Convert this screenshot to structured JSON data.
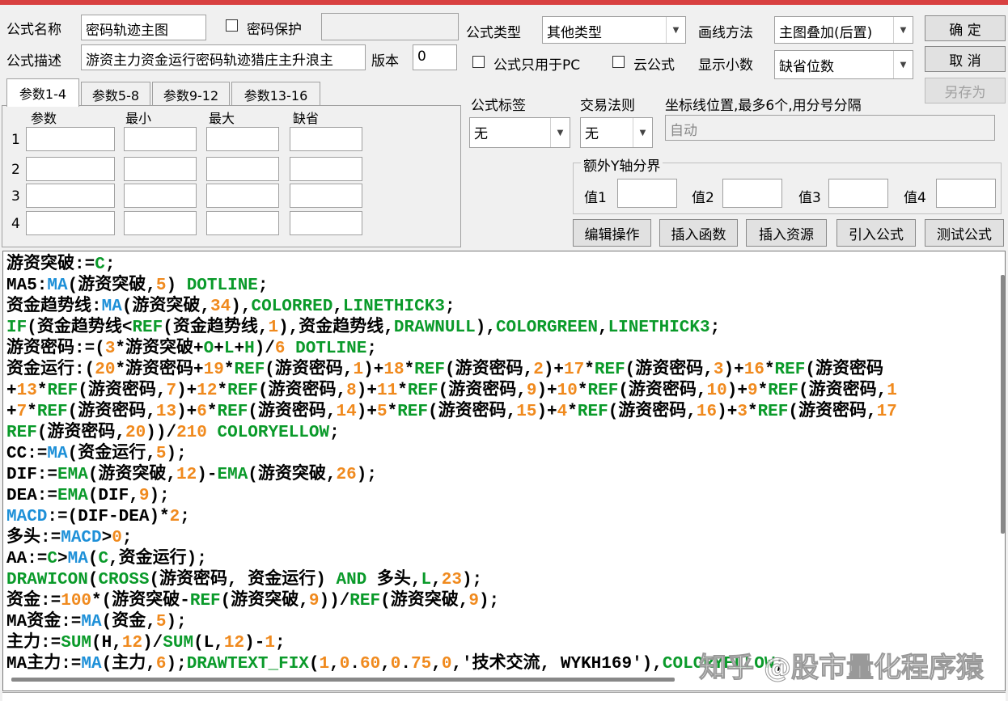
{
  "form": {
    "name_label": "公式名称",
    "name_value": "密码轨迹主图",
    "password_label": "密码保护",
    "password_value": "",
    "desc_label": "公式描述",
    "desc_value": "游资主力资金运行密码轨迹猎庄主升浪主",
    "version_label": "版本",
    "version_value": "0",
    "type_label": "公式类型",
    "type_value": "其他类型",
    "draw_label": "画线方法",
    "draw_value": "主图叠加(后置)",
    "pc_only_label": "公式只用于PC",
    "cloud_label": "云公式",
    "decimal_label": "显示小数",
    "decimal_value": "缺省位数",
    "ok": "确  定",
    "cancel": "取  消",
    "save_as": "另存为"
  },
  "tabs": [
    "参数1-4",
    "参数5-8",
    "参数9-12",
    "参数13-16"
  ],
  "params": {
    "headers": [
      "参数",
      "最小",
      "最大",
      "缺省"
    ],
    "rows": [
      "1",
      "2",
      "3",
      "4"
    ]
  },
  "tag": {
    "label": "公式标签",
    "value": "无"
  },
  "rule": {
    "label": "交易法则",
    "value": "无"
  },
  "axis": {
    "label": "坐标线位置,最多6个,用分号分隔",
    "value": "自动"
  },
  "yaxis": {
    "title": "额外Y轴分界",
    "fields": [
      "值1",
      "值2",
      "值3",
      "值4"
    ]
  },
  "actions": [
    "编辑操作",
    "插入函数",
    "插入资源",
    "引入公式",
    "测试公式"
  ],
  "code": [
    [
      [
        "游资突破:=",
        "k"
      ],
      [
        "C",
        "g"
      ],
      [
        ";",
        "k"
      ]
    ],
    [
      [
        "MA5:",
        "k"
      ],
      [
        "MA",
        "b"
      ],
      [
        "(游资突破,",
        "k"
      ],
      [
        "5",
        "o"
      ],
      [
        ") ",
        "k"
      ],
      [
        "DOTLINE",
        "g"
      ],
      [
        ";",
        "k"
      ]
    ],
    [
      [
        "资金趋势线:",
        "k"
      ],
      [
        "MA",
        "b"
      ],
      [
        "(游资突破,",
        "k"
      ],
      [
        "34",
        "o"
      ],
      [
        "),",
        "k"
      ],
      [
        "COLORRED",
        "g"
      ],
      [
        ",",
        "k"
      ],
      [
        "LINETHICK3",
        "g"
      ],
      [
        ";",
        "k"
      ]
    ],
    [
      [
        "IF",
        "g"
      ],
      [
        "(资金趋势线<",
        "k"
      ],
      [
        "REF",
        "g"
      ],
      [
        "(资金趋势线,",
        "k"
      ],
      [
        "1",
        "o"
      ],
      [
        "),资金趋势线,",
        "k"
      ],
      [
        "DRAWNULL",
        "g"
      ],
      [
        "),",
        "k"
      ],
      [
        "COLORGREEN",
        "g"
      ],
      [
        ",",
        "k"
      ],
      [
        "LINETHICK3",
        "g"
      ],
      [
        ";",
        "k"
      ]
    ],
    [
      [
        "游资密码:=(",
        "k"
      ],
      [
        "3",
        "o"
      ],
      [
        "*游资突破+",
        "k"
      ],
      [
        "O",
        "g"
      ],
      [
        "+",
        "k"
      ],
      [
        "L",
        "g"
      ],
      [
        "+",
        "k"
      ],
      [
        "H",
        "g"
      ],
      [
        ")/",
        "k"
      ],
      [
        "6",
        "o"
      ],
      [
        " ",
        "k"
      ],
      [
        "DOTLINE",
        "g"
      ],
      [
        ";",
        "k"
      ]
    ],
    [
      [
        "资金运行:(",
        "k"
      ],
      [
        "20",
        "o"
      ],
      [
        "*游资密码+",
        "k"
      ],
      [
        "19",
        "o"
      ],
      [
        "*",
        "k"
      ],
      [
        "REF",
        "g"
      ],
      [
        "(游资密码,",
        "k"
      ],
      [
        "1",
        "o"
      ],
      [
        ")+",
        "k"
      ],
      [
        "18",
        "o"
      ],
      [
        "*",
        "k"
      ],
      [
        "REF",
        "g"
      ],
      [
        "(游资密码,",
        "k"
      ],
      [
        "2",
        "o"
      ],
      [
        ")+",
        "k"
      ],
      [
        "17",
        "o"
      ],
      [
        "*",
        "k"
      ],
      [
        "REF",
        "g"
      ],
      [
        "(游资密码,",
        "k"
      ],
      [
        "3",
        "o"
      ],
      [
        ")+",
        "k"
      ],
      [
        "16",
        "o"
      ],
      [
        "*",
        "k"
      ],
      [
        "REF",
        "g"
      ],
      [
        "(游资密码",
        "k"
      ]
    ],
    [
      [
        "+",
        "k"
      ],
      [
        "13",
        "o"
      ],
      [
        "*",
        "k"
      ],
      [
        "REF",
        "g"
      ],
      [
        "(游资密码,",
        "k"
      ],
      [
        "7",
        "o"
      ],
      [
        ")+",
        "k"
      ],
      [
        "12",
        "o"
      ],
      [
        "*",
        "k"
      ],
      [
        "REF",
        "g"
      ],
      [
        "(游资密码,",
        "k"
      ],
      [
        "8",
        "o"
      ],
      [
        ")+",
        "k"
      ],
      [
        "11",
        "o"
      ],
      [
        "*",
        "k"
      ],
      [
        "REF",
        "g"
      ],
      [
        "(游资密码,",
        "k"
      ],
      [
        "9",
        "o"
      ],
      [
        ")+",
        "k"
      ],
      [
        "10",
        "o"
      ],
      [
        "*",
        "k"
      ],
      [
        "REF",
        "g"
      ],
      [
        "(游资密码,",
        "k"
      ],
      [
        "10",
        "o"
      ],
      [
        ")+",
        "k"
      ],
      [
        "9",
        "o"
      ],
      [
        "*",
        "k"
      ],
      [
        "REF",
        "g"
      ],
      [
        "(游资密码,",
        "k"
      ],
      [
        "1",
        "o"
      ]
    ],
    [
      [
        "+",
        "k"
      ],
      [
        "7",
        "o"
      ],
      [
        "*",
        "k"
      ],
      [
        "REF",
        "g"
      ],
      [
        "(游资密码,",
        "k"
      ],
      [
        "13",
        "o"
      ],
      [
        ")+",
        "k"
      ],
      [
        "6",
        "o"
      ],
      [
        "*",
        "k"
      ],
      [
        "REF",
        "g"
      ],
      [
        "(游资密码,",
        "k"
      ],
      [
        "14",
        "o"
      ],
      [
        ")+",
        "k"
      ],
      [
        "5",
        "o"
      ],
      [
        "*",
        "k"
      ],
      [
        "REF",
        "g"
      ],
      [
        "(游资密码,",
        "k"
      ],
      [
        "15",
        "o"
      ],
      [
        ")+",
        "k"
      ],
      [
        "4",
        "o"
      ],
      [
        "*",
        "k"
      ],
      [
        "REF",
        "g"
      ],
      [
        "(游资密码,",
        "k"
      ],
      [
        "16",
        "o"
      ],
      [
        ")+",
        "k"
      ],
      [
        "3",
        "o"
      ],
      [
        "*",
        "k"
      ],
      [
        "REF",
        "g"
      ],
      [
        "(游资密码,",
        "k"
      ],
      [
        "17",
        "o"
      ]
    ],
    [
      [
        "REF",
        "g"
      ],
      [
        "(游资密码,",
        "k"
      ],
      [
        "20",
        "o"
      ],
      [
        "))/",
        "k"
      ],
      [
        "210",
        "o"
      ],
      [
        " ",
        "k"
      ],
      [
        "COLORYELLOW",
        "g"
      ],
      [
        ";",
        "k"
      ]
    ],
    [
      [
        "CC:=",
        "k"
      ],
      [
        "MA",
        "b"
      ],
      [
        "(资金运行,",
        "k"
      ],
      [
        "5",
        "o"
      ],
      [
        ");",
        "k"
      ]
    ],
    [
      [
        "DIF:=",
        "k"
      ],
      [
        "EMA",
        "g"
      ],
      [
        "(游资突破,",
        "k"
      ],
      [
        "12",
        "o"
      ],
      [
        ")-",
        "k"
      ],
      [
        "EMA",
        "g"
      ],
      [
        "(游资突破,",
        "k"
      ],
      [
        "26",
        "o"
      ],
      [
        ");",
        "k"
      ]
    ],
    [
      [
        "DEA:=",
        "k"
      ],
      [
        "EMA",
        "g"
      ],
      [
        "(DIF,",
        "k"
      ],
      [
        "9",
        "o"
      ],
      [
        ");",
        "k"
      ]
    ],
    [
      [
        "MACD",
        "b"
      ],
      [
        ":=(DIF-DEA)*",
        "k"
      ],
      [
        "2",
        "o"
      ],
      [
        ";",
        "k"
      ]
    ],
    [
      [
        "多头:=",
        "k"
      ],
      [
        "MACD",
        "b"
      ],
      [
        ">",
        "k"
      ],
      [
        "0",
        "o"
      ],
      [
        ";",
        "k"
      ]
    ],
    [
      [
        "AA:=",
        "k"
      ],
      [
        "C",
        "g"
      ],
      [
        ">",
        "k"
      ],
      [
        "MA",
        "b"
      ],
      [
        "(",
        "k"
      ],
      [
        "C",
        "g"
      ],
      [
        ",资金运行);",
        "k"
      ]
    ],
    [
      [
        "DRAWICON",
        "g"
      ],
      [
        "(",
        "k"
      ],
      [
        "CROSS",
        "g"
      ],
      [
        "(游资密码, 资金运行) ",
        "k"
      ],
      [
        "AND",
        "g"
      ],
      [
        " 多头,",
        "k"
      ],
      [
        "L",
        "g"
      ],
      [
        ",",
        "k"
      ],
      [
        "23",
        "o"
      ],
      [
        ");",
        "k"
      ]
    ],
    [
      [
        "资金:=",
        "k"
      ],
      [
        "100",
        "o"
      ],
      [
        "*(游资突破-",
        "k"
      ],
      [
        "REF",
        "g"
      ],
      [
        "(游资突破,",
        "k"
      ],
      [
        "9",
        "o"
      ],
      [
        "))/",
        "k"
      ],
      [
        "REF",
        "g"
      ],
      [
        "(游资突破,",
        "k"
      ],
      [
        "9",
        "o"
      ],
      [
        ");",
        "k"
      ]
    ],
    [
      [
        "MA资金:=",
        "k"
      ],
      [
        "MA",
        "b"
      ],
      [
        "(资金,",
        "k"
      ],
      [
        "5",
        "o"
      ],
      [
        ");",
        "k"
      ]
    ],
    [
      [
        "主力:=",
        "k"
      ],
      [
        "SUM",
        "g"
      ],
      [
        "(H,",
        "k"
      ],
      [
        "12",
        "o"
      ],
      [
        ")/",
        "k"
      ],
      [
        "SUM",
        "g"
      ],
      [
        "(L,",
        "k"
      ],
      [
        "12",
        "o"
      ],
      [
        ")-",
        "k"
      ],
      [
        "1",
        "o"
      ],
      [
        ";",
        "k"
      ]
    ],
    [
      [
        "MA主力:=",
        "k"
      ],
      [
        "MA",
        "b"
      ],
      [
        "(主力,",
        "k"
      ],
      [
        "6",
        "o"
      ],
      [
        ");",
        "k"
      ],
      [
        "DRAWTEXT_FIX",
        "g"
      ],
      [
        "(",
        "k"
      ],
      [
        "1",
        "o"
      ],
      [
        ",",
        "k"
      ],
      [
        "0",
        "o"
      ],
      [
        ".",
        "k"
      ],
      [
        "60",
        "o"
      ],
      [
        ",",
        "k"
      ],
      [
        "0",
        "o"
      ],
      [
        ".",
        "k"
      ],
      [
        "75",
        "o"
      ],
      [
        ",",
        "k"
      ],
      [
        "0",
        "o"
      ],
      [
        ",'技术交流, WYKH169'),",
        "k"
      ],
      [
        "COLORYELLOW",
        "g"
      ],
      [
        ";",
        "k"
      ]
    ]
  ],
  "watermark": "知乎 @股市量化程序猿",
  "colors": {
    "green": "#0a9a2a",
    "blue": "#1e90d8",
    "orange": "#f08a1e"
  }
}
